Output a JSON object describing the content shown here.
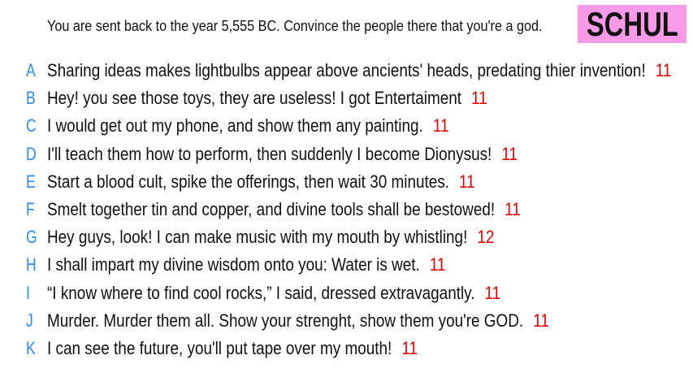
{
  "prompt": "You are sent back to the year 5,555 BC. Convince the people there that you're a god.",
  "badge": {
    "label": "SCHUL",
    "color": "#f99ae9"
  },
  "colors": {
    "letter": "#2b8cf0",
    "score": "#e60000"
  },
  "answers": [
    {
      "letter": "A",
      "text": "Sharing ideas makes lightbulbs appear above ancients' heads, predating thier invention!",
      "score": "11"
    },
    {
      "letter": "B",
      "text": "Hey! you see those toys, they are useless! I got Entertaiment",
      "score": "11"
    },
    {
      "letter": "C",
      "text": "I would get out my phone, and show them any painting.",
      "score": "11"
    },
    {
      "letter": "D",
      "text": "I'll teach them how to perform, then suddenly I become Dionysus!",
      "score": "11"
    },
    {
      "letter": "E",
      "text": "Start a blood cult, spike the offerings, then wait 30 minutes.",
      "score": "11"
    },
    {
      "letter": "F",
      "text": "Smelt together tin and copper, and divine tools shall be bestowed!",
      "score": "11"
    },
    {
      "letter": "G",
      "text": "Hey guys, look! I can make music with my mouth by whistling!",
      "score": "12"
    },
    {
      "letter": "H",
      "text": "I shall impart my divine wisdom onto you: Water is wet.",
      "score": "11"
    },
    {
      "letter": "I",
      "text": "“I know where to find cool rocks,” I said, dressed extravagantly.",
      "score": "11"
    },
    {
      "letter": "J",
      "text": "Murder. Murder them all. Show your strenght, show them you're GOD.",
      "score": "11"
    },
    {
      "letter": "K",
      "text": "I can see the future, you'll put tape over my mouth!",
      "score": "11"
    }
  ]
}
